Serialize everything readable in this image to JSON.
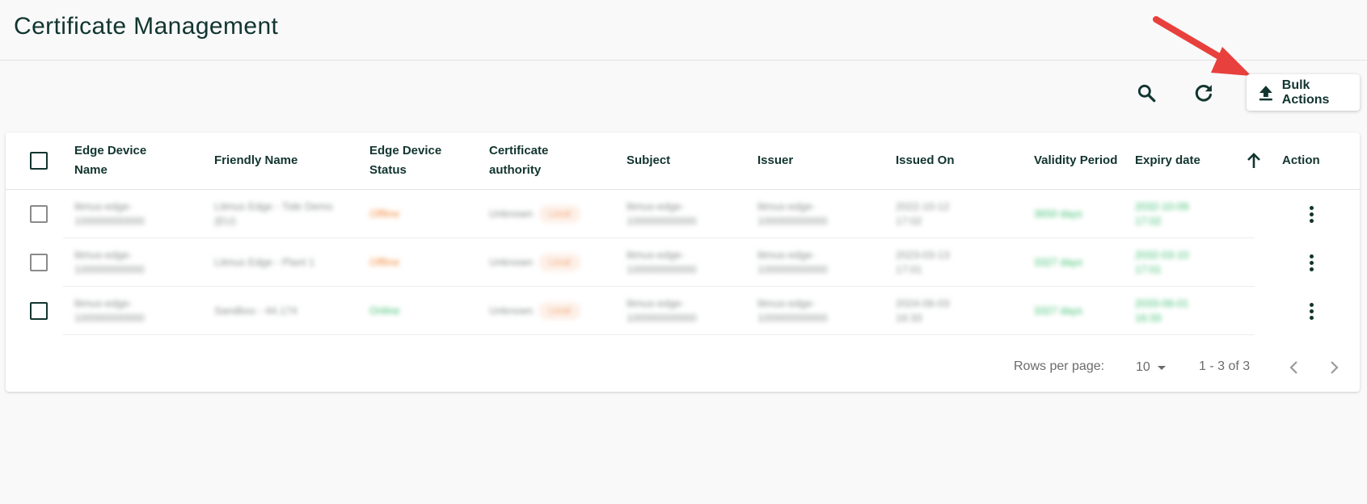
{
  "page": {
    "title": "Certificate Management"
  },
  "toolbar": {
    "search_icon": "search-icon",
    "refresh_icon": "refresh-icon",
    "bulk_actions_label": "Bulk Actions",
    "bulk_actions_icon": "upload-icon"
  },
  "annotation": {
    "arrow_color": "#e8403c"
  },
  "table": {
    "columns": {
      "edge_device_name": "Edge Device Name",
      "friendly_name": "Friendly Name",
      "edge_device_status": "Edge Device Status",
      "certificate_authority": "Certificate authority",
      "subject": "Subject",
      "issuer": "Issuer",
      "issued_on": "Issued On",
      "validity_period": "Validity Period",
      "expiry_date": "Expiry date",
      "sort_icon": "arrow-up-icon",
      "action": "Action"
    },
    "rows": [
      {
        "device_name": "litmus-edge-100000000000",
        "friendly_name": "Litmus Edge - Tide Demo (EU)",
        "status": "Offline",
        "ca": "Unknown",
        "ca_badge": "Local",
        "subject": "litmus-edge-100000000000",
        "issuer": "litmus-edge-100000000000",
        "issued_on": "2022-10-12 17:02",
        "validity": "3650 days",
        "expiry": "2032-10-09 17:02"
      },
      {
        "device_name": "litmus-edge-100000000000",
        "friendly_name": "Litmus Edge - Plant 1",
        "status": "Offline",
        "ca": "Unknown",
        "ca_badge": "Local",
        "subject": "litmus-edge-100000000000",
        "issuer": "litmus-edge-100000000000",
        "issued_on": "2023-03-13 17:01",
        "validity": "3327 days",
        "expiry": "2032-03-10 17:01"
      },
      {
        "device_name": "litmus-edge-100000000000",
        "friendly_name": "Sandbox - 44.174",
        "status": "Online",
        "ca": "Unknown",
        "ca_badge": "Local",
        "subject": "litmus-edge-100000000000",
        "issuer": "litmus-edge-100000000000",
        "issued_on": "2024-06-03 16:33",
        "validity": "3327 days",
        "expiry": "2033-06-01 16:33"
      }
    ],
    "row_checkbox_checked": [
      false,
      false,
      false
    ]
  },
  "pagination": {
    "rows_per_page_label": "Rows per page:",
    "rows_per_page_value": "10",
    "range_label": "1 - 3 of 3"
  },
  "colors": {
    "primary": "#12352f",
    "offline": "#f28a3c",
    "online": "#3fbf72",
    "arrow": "#e8403c"
  }
}
